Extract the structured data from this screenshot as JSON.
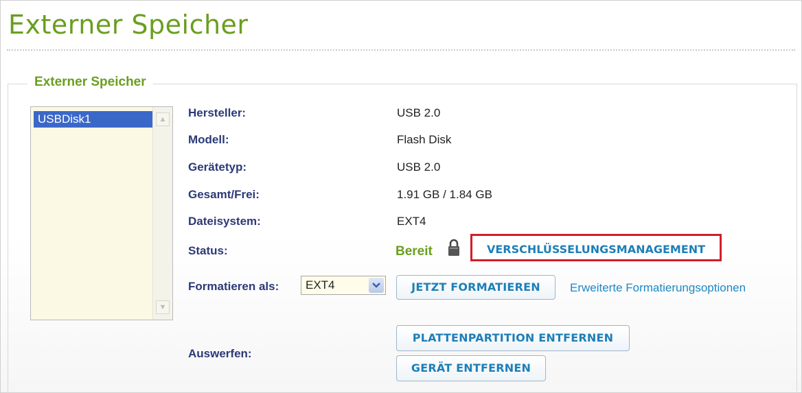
{
  "page_title": "Externer Speicher",
  "section_title": "Externer Speicher",
  "disk_list": {
    "items": [
      "USBDisk1"
    ],
    "selected": "USBDisk1"
  },
  "details": {
    "manufacturer_label": "Hersteller:",
    "manufacturer_value": "USB 2.0",
    "model_label": "Modell:",
    "model_value": "Flash Disk",
    "device_type_label": "Gerätetyp:",
    "device_type_value": "USB 2.0",
    "total_free_label": "Gesamt/Frei:",
    "total_free_value": "1.91 GB / 1.84 GB",
    "filesystem_label": "Dateisystem:",
    "filesystem_value": "EXT4",
    "status_label": "Status:",
    "status_value": "Bereit"
  },
  "actions": {
    "encryption_button": "VERSCHLÜSSELUNGSMANAGEMENT",
    "format_label": "Formatieren als:",
    "format_selected": "EXT4",
    "format_now_button": "JETZT FORMATIEREN",
    "advanced_format_link": "Erweiterte Formatierungsoptionen",
    "eject_label": "Auswerfen:",
    "remove_partition_button": "PLATTENPARTITION ENTFERNEN",
    "remove_device_button": "GERÄT ENTFERNEN"
  },
  "colors": {
    "title_green": "#6a9e1f",
    "label_navy": "#2b3a77",
    "button_text_blue": "#1d7fb8",
    "highlight_red": "#d21d2a",
    "selected_item_blue": "#3b68c8"
  },
  "icons": {
    "status_icon": "lock-icon",
    "select_arrow": "chevron-down-icon",
    "scroll_up": "scroll-up-icon",
    "scroll_down": "scroll-down-icon"
  }
}
